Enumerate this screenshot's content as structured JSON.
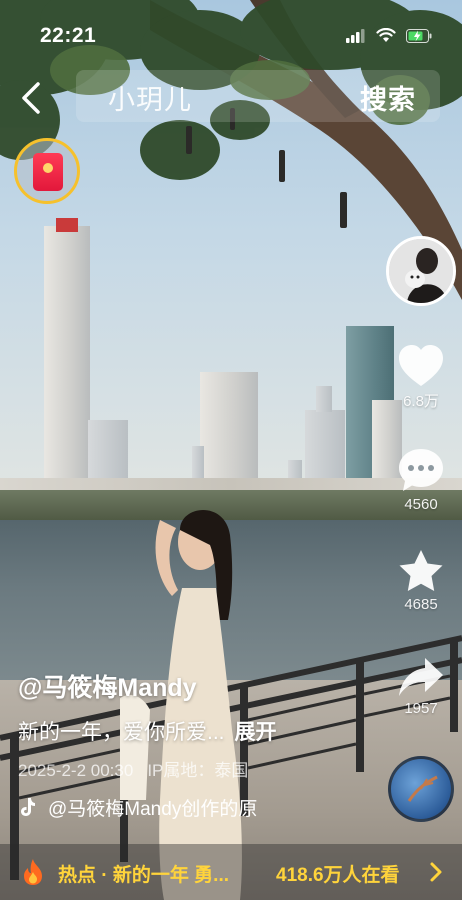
{
  "status_bar": {
    "time": "22:21",
    "icons": [
      "signal-icon",
      "wifi-icon",
      "battery-charging-icon"
    ]
  },
  "search": {
    "query": "小玥儿",
    "button_label": "搜索",
    "back_icon": "chevron-left-icon"
  },
  "red_packet": {
    "icon": "red-envelope-icon"
  },
  "side_actions": {
    "avatar": {
      "icon": "user-avatar"
    },
    "like": {
      "icon": "heart-icon",
      "count": "6.8万"
    },
    "comment": {
      "icon": "comment-bubble-icon",
      "count": "4560"
    },
    "favorite": {
      "icon": "star-icon",
      "count": "4685"
    },
    "share": {
      "icon": "share-arrow-icon",
      "count": "1957"
    },
    "music_disc": {
      "icon": "music-disc"
    }
  },
  "post": {
    "author": "@马筱梅Mandy",
    "caption": "新的一年，爱你所爱...",
    "expand_label": "展开",
    "date": "2025-2-2 00:30",
    "location": "IP属地：泰国",
    "music": "@马筱梅Mandy创作的原",
    "music_icon": "tiktok-note-icon"
  },
  "hot_bar": {
    "topic": "热点 · 新的一年 勇...",
    "viewers": "418.6万人在看",
    "flame_icon": "flame-icon",
    "arrow_icon": "chevron-right-icon"
  },
  "colors": {
    "accent_yellow": "#ffd43b",
    "red_packet": "#e2183b",
    "text": "#ffffff"
  }
}
